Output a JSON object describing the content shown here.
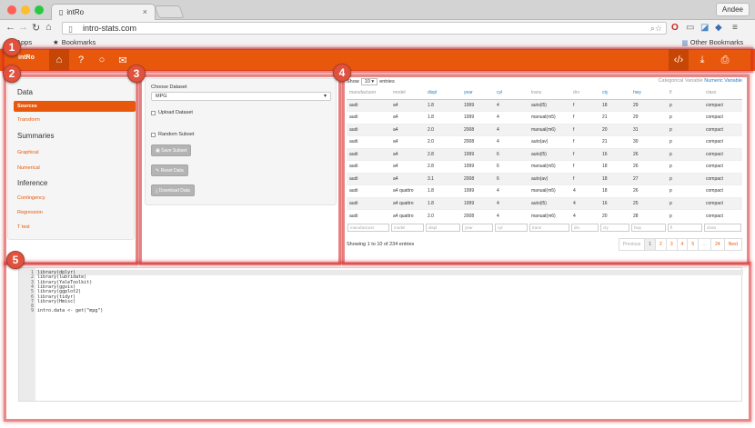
{
  "browser": {
    "tab_title": "intRo",
    "tab_close": "×",
    "url": "intro-stats.com",
    "user": "Andee",
    "bookmarks": {
      "apps": "Apps",
      "bookmarks": "Bookmarks",
      "other": "Other Bookmarks"
    },
    "traffic_colors": [
      "#ff5f57",
      "#ffbd2e",
      "#28c940"
    ]
  },
  "app": {
    "brand": "intRo",
    "accent": "#e8580c",
    "nav_icons": [
      "home-icon",
      "help-icon",
      "github-icon",
      "mail-icon"
    ],
    "right_icons": [
      "code-icon",
      "download-icon",
      "print-icon"
    ]
  },
  "callouts": [
    "1",
    "2",
    "3",
    "4",
    "5"
  ],
  "sidebar": {
    "sections": [
      {
        "title": "Data",
        "items": [
          "Sources",
          "Transform"
        ]
      },
      {
        "title": "Summaries",
        "items": [
          "Graphical",
          "Numerical"
        ]
      },
      {
        "title": "Inference",
        "items": [
          "Contingency",
          "Regression",
          "T test"
        ]
      }
    ],
    "active": "Sources"
  },
  "dataset": {
    "label": "Choose Dataset",
    "selected": "MPG",
    "upload_label": "Upload Dataset",
    "random_label": "Random Subset",
    "save_label": "Save Subset",
    "reset_label": "Reset Data",
    "download_label": "Download Data"
  },
  "table": {
    "show_prefix": "Show",
    "entries_value": "10",
    "show_suffix": "entries",
    "var_cat": "Categorical Variable",
    "var_num": "Numeric Variable",
    "columns": [
      "manufacturer",
      "model",
      "displ",
      "year",
      "cyl",
      "trans",
      "drv",
      "cty",
      "hwy",
      "fl",
      "class"
    ],
    "numeric_columns": [
      2,
      3,
      4,
      7,
      8
    ],
    "rows": [
      [
        "audi",
        "a4",
        "1.8",
        "1999",
        "4",
        "auto(l5)",
        "f",
        "18",
        "29",
        "p",
        "compact"
      ],
      [
        "audi",
        "a4",
        "1.8",
        "1999",
        "4",
        "manual(m5)",
        "f",
        "21",
        "29",
        "p",
        "compact"
      ],
      [
        "audi",
        "a4",
        "2.0",
        "2008",
        "4",
        "manual(m6)",
        "f",
        "20",
        "31",
        "p",
        "compact"
      ],
      [
        "audi",
        "a4",
        "2.0",
        "2008",
        "4",
        "auto(av)",
        "f",
        "21",
        "30",
        "p",
        "compact"
      ],
      [
        "audi",
        "a4",
        "2.8",
        "1999",
        "6",
        "auto(l5)",
        "f",
        "16",
        "26",
        "p",
        "compact"
      ],
      [
        "audi",
        "a4",
        "2.8",
        "1999",
        "6",
        "manual(m5)",
        "f",
        "18",
        "26",
        "p",
        "compact"
      ],
      [
        "audi",
        "a4",
        "3.1",
        "2008",
        "6",
        "auto(av)",
        "f",
        "18",
        "27",
        "p",
        "compact"
      ],
      [
        "audi",
        "a4 quattro",
        "1.8",
        "1999",
        "4",
        "manual(m5)",
        "4",
        "18",
        "26",
        "p",
        "compact"
      ],
      [
        "audi",
        "a4 quattro",
        "1.8",
        "1999",
        "4",
        "auto(l5)",
        "4",
        "16",
        "25",
        "p",
        "compact"
      ],
      [
        "audi",
        "a4 quattro",
        "2.0",
        "2008",
        "4",
        "manual(m6)",
        "4",
        "20",
        "28",
        "p",
        "compact"
      ]
    ],
    "showing": "Showing 1 to 10 of 234 entries",
    "pages": [
      "Previous",
      "1",
      "2",
      "3",
      "4",
      "5",
      "…",
      "24",
      "Next"
    ]
  },
  "editor": {
    "lines": [
      "library(dplyr)",
      "library(lubridate)",
      "library(YaleToolkit)",
      "library(ggvis)",
      "library(ggplot2)",
      "library(tidyr)",
      "library(Hmisc)",
      "",
      "intro.data <- get(\"mpg\")"
    ]
  }
}
